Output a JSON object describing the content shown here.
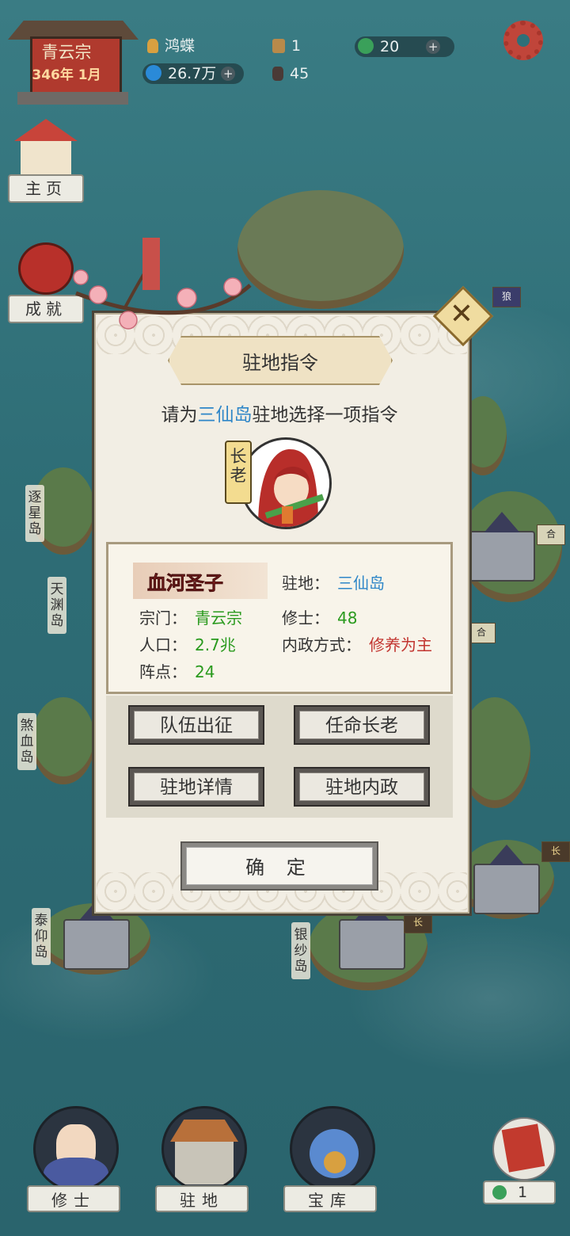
{
  "sect": {
    "name": "青云宗",
    "date": "346年 1月"
  },
  "resources": {
    "leader": "鸿蝶",
    "spirit_stones": "26.7万",
    "buildings": "1",
    "disciples": "45",
    "jade": "20",
    "plus_icon": "+"
  },
  "side_nav": [
    {
      "label": "主页"
    },
    {
      "label": "成就"
    }
  ],
  "islands": [
    {
      "label": "逐星岛"
    },
    {
      "label": "天渊岛"
    },
    {
      "label": "煞血岛"
    },
    {
      "label": "泰仰岛"
    },
    {
      "label": "银纱岛"
    }
  ],
  "flags": [
    "狼",
    "合",
    "合",
    "长",
    "长"
  ],
  "dialog": {
    "title": "驻地指令",
    "prompt_prefix": "请为",
    "prompt_island": "三仙岛",
    "prompt_suffix": "驻地选择一项指令",
    "close_icon": "✕",
    "elder_tag": "长老",
    "character_name": "血河圣子",
    "fields": {
      "station_label": "驻地：",
      "station_value": "三仙岛",
      "sect_label": "宗门：",
      "sect_value": "青云宗",
      "cultivators_label": "修士：",
      "cultivators_value": "48",
      "population_label": "人口：",
      "population_value": "2.7兆",
      "policy_label": "内政方式：",
      "policy_value": "修养为主",
      "formation_label": "阵点：",
      "formation_value": "24"
    },
    "buttons": {
      "expedition": "队伍出征",
      "appoint_elder": "任命长老",
      "station_details": "驻地详情",
      "station_affairs": "驻地内政"
    },
    "confirm": "确 定"
  },
  "bottom_nav": [
    {
      "label": "修士"
    },
    {
      "label": "驻地"
    },
    {
      "label": "宝库"
    }
  ],
  "war_flag_count": "1",
  "colors": {
    "sea": "#2f6f78",
    "highlight_blue": "#2e86c8",
    "value_green": "#2a9a1e",
    "value_red": "#c23530",
    "gear_red": "#c0453a"
  }
}
